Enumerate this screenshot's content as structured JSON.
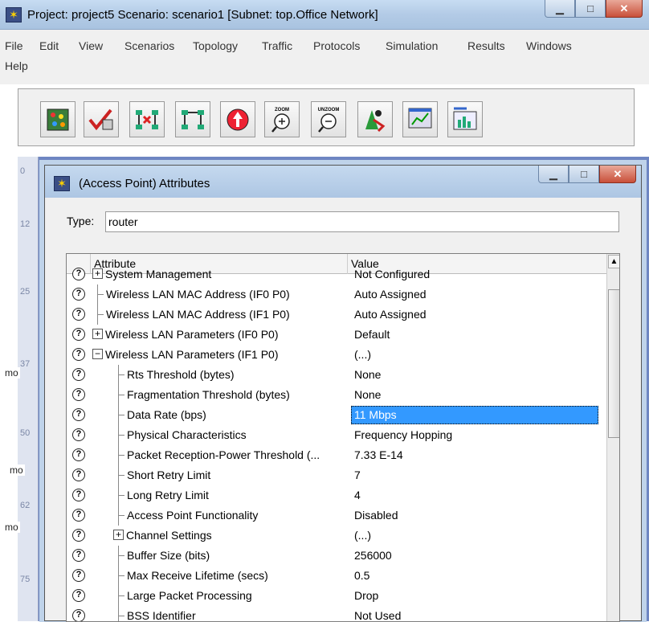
{
  "main_window": {
    "title": "Project: project5 Scenario: scenario1  [Subnet: top.Office Network]",
    "menu": [
      "File",
      "Edit",
      "View",
      "Scenarios",
      "Topology",
      "Traffic",
      "Protocols",
      "Simulation",
      "Results",
      "Windows",
      "Help"
    ],
    "toolbar_icons": [
      "open-palette-icon",
      "verify-links-icon",
      "fail-node-icon",
      "recover-node-icon",
      "return-to-parent-icon",
      "zoom-icon",
      "unzoom-icon",
      "run-des-icon",
      "view-results-icon",
      "hide-graphs-icon"
    ],
    "toolbar_labels": {
      "zoom": "ZOOM",
      "unzoom": "UNZOOM"
    }
  },
  "workspace": {
    "ruler_labels": [
      "0",
      "12",
      "25",
      "37",
      "50",
      "62",
      "75"
    ],
    "labels": [
      "mo",
      "mo",
      "mo"
    ]
  },
  "dialog": {
    "title": "(Access Point) Attributes",
    "type_label": "Type:",
    "type_value": "router",
    "columns": {
      "attribute": "Attribute",
      "value": "Value"
    },
    "rows": [
      {
        "label": "System Management",
        "value": "Not Configured"
      },
      {
        "label": "Wireless LAN MAC Address (IF0 P0)",
        "value": "Auto Assigned"
      },
      {
        "label": "Wireless LAN MAC Address (IF1 P0)",
        "value": "Auto Assigned"
      },
      {
        "label": "Wireless LAN Parameters (IF0 P0)",
        "value": "Default"
      },
      {
        "label": "Wireless LAN Parameters (IF1 P0)",
        "value": "(...)"
      },
      {
        "label": "Rts Threshold (bytes)",
        "value": "None"
      },
      {
        "label": "Fragmentation Threshold (bytes)",
        "value": "None"
      },
      {
        "label": "Data Rate (bps)",
        "value": "11 Mbps"
      },
      {
        "label": "Physical Characteristics",
        "value": "Frequency Hopping"
      },
      {
        "label": "Packet Reception-Power Threshold (...",
        "value": "7.33 E-14"
      },
      {
        "label": "Short Retry Limit",
        "value": "7"
      },
      {
        "label": "Long Retry Limit",
        "value": "4"
      },
      {
        "label": "Access Point Functionality",
        "value": "Disabled"
      },
      {
        "label": "Channel Settings",
        "value": "(...)"
      },
      {
        "label": "Buffer Size (bits)",
        "value": "256000"
      },
      {
        "label": "Max Receive Lifetime (secs)",
        "value": "0.5"
      },
      {
        "label": "Large Packet Processing",
        "value": "Drop"
      },
      {
        "label": "BSS Identifier",
        "value": "Not Used"
      }
    ],
    "selected_row": "Data Rate (bps)"
  },
  "colors": {
    "selection": "#3399ff",
    "workspace": "#6e86c2",
    "titlebar": "#b3cbe6"
  }
}
